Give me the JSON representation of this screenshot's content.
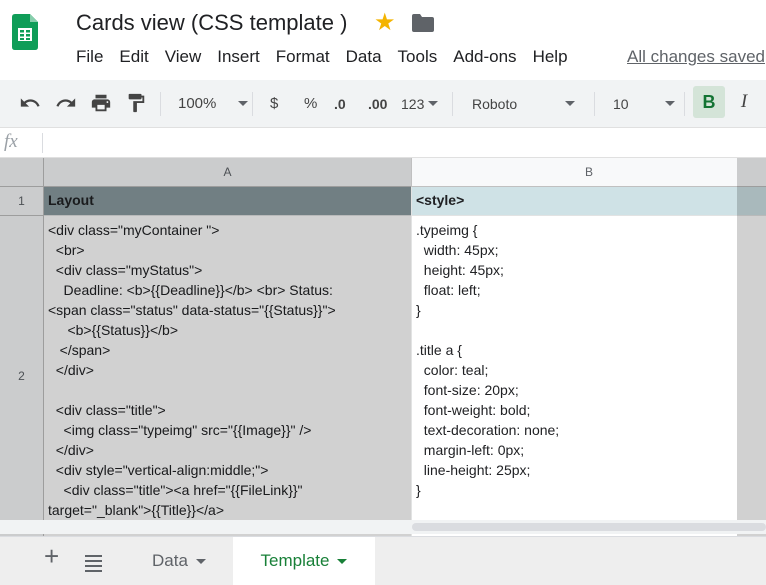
{
  "window": {
    "title": "Cards view (CSS template )"
  },
  "menu": [
    "File",
    "Edit",
    "View",
    "Insert",
    "Format",
    "Data",
    "Tools",
    "Add-ons",
    "Help"
  ],
  "save_status": "All changes saved",
  "toolbar": {
    "zoom": "100%",
    "currency": "$",
    "percent": "%",
    "dec_decrease": ".0",
    "dec_increase": ".00",
    "more_formats": "123",
    "font": "Roboto",
    "font_size": "10",
    "bold": "B",
    "italic": "I"
  },
  "formula_bar": {
    "fx_label": "fx",
    "value": ""
  },
  "columns": [
    "A",
    "B"
  ],
  "rows": [
    "1",
    "2"
  ],
  "cells": {
    "A1": "Layout",
    "B1": "<style>",
    "A2": "<div class=\"myContainer \">\n  <br>\n  <div class=\"myStatus\">\n    Deadline: <b>{{Deadline}}</b> <br> Status:\n<span class=\"status\" data-status=\"{{Status}}\">\n     <b>{{Status}}</b>\n   </span>\n  </div>\n\n  <div class=\"title\">\n    <img class=\"typeimg\" src=\"{{Image}}\" />\n  </div>\n  <div style=\"vertical-align:middle;\">\n    <div class=\"title\"><a href=\"{{FileLink}}\"\ntarget=\"_blank\">{{Title}}</a>",
    "B2": ".typeimg {\n  width: 45px;\n  height: 45px;\n  float: left;\n}\n\n.title a {\n  color: teal;\n  font-size: 20px;\n  font-weight: bold;\n  text-decoration: none;\n  margin-left: 0px;\n  line-height: 25px;\n}"
  },
  "sheet_tabs": {
    "data": "Data",
    "template": "Template",
    "active": "Template"
  },
  "colors": {
    "accent": "#188038",
    "header_row_bg": "#8a9ca0",
    "star": "#f4b400"
  }
}
